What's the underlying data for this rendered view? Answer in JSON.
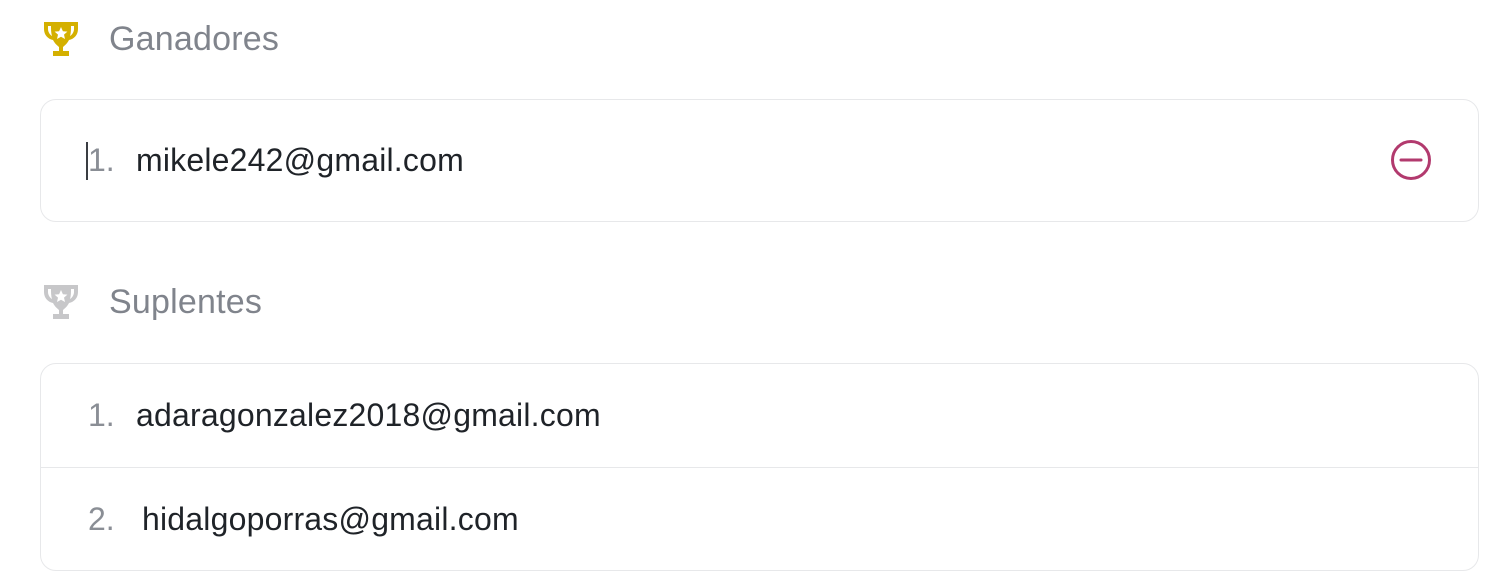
{
  "winners": {
    "title": "Ganadores",
    "icon": "trophy-icon",
    "icon_color": "#d4b000",
    "items": [
      {
        "number": "1.",
        "email": "mikele242@gmail.com"
      }
    ],
    "remove_icon": "minus-circle-icon",
    "remove_color": "#b23a6e"
  },
  "substitutes": {
    "title": "Suplentes",
    "icon": "trophy-icon",
    "icon_color": "#c7c7c9",
    "items": [
      {
        "number": "1.",
        "email": "adaragonzalez2018@gmail.com"
      },
      {
        "number": "2.",
        "email": "hidalgoporras@gmail.com"
      }
    ]
  }
}
